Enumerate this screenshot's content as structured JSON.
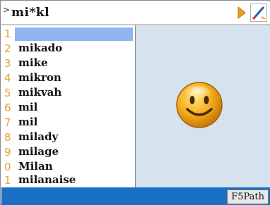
{
  "search": {
    "prompt_glyph": ">",
    "query": "mi*kl"
  },
  "toolbar": {
    "arrow_color": "#f0a020",
    "pen_accent": "#e53030"
  },
  "list": {
    "items": [
      {
        "num": "1",
        "word": ""
      },
      {
        "num": "2",
        "word": "mikado"
      },
      {
        "num": "3",
        "word": "mike"
      },
      {
        "num": "4",
        "word": "mikron"
      },
      {
        "num": "5",
        "word": "mikvah"
      },
      {
        "num": "6",
        "word": "mil"
      },
      {
        "num": "7",
        "word": "mil"
      },
      {
        "num": "8",
        "word": "milady"
      },
      {
        "num": "9",
        "word": "milage"
      },
      {
        "num": "0",
        "word": "Milan"
      },
      {
        "num": "1",
        "word": "milanaise"
      }
    ]
  },
  "preview": {
    "icon": "smiley-face-icon"
  },
  "status": {
    "fspath_label": "F5Path"
  },
  "colors": {
    "selection": "#90b4ec",
    "pane": "#d6e3ef",
    "statusbar": "#1a6fc4",
    "numbers": "#e8a030"
  }
}
